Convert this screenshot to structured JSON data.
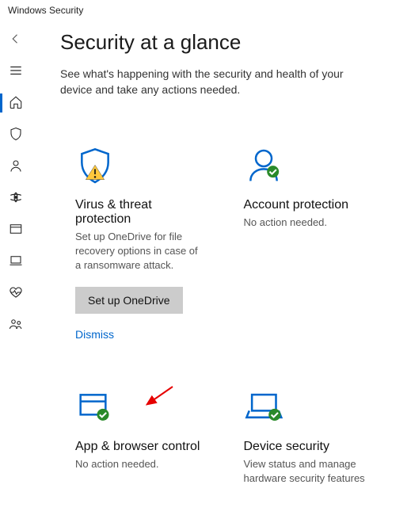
{
  "window_title": "Windows Security",
  "page": {
    "title": "Security at a glance",
    "subtitle": "See what's happening with the security and health of your device and take any actions needed."
  },
  "sidebar": [
    {
      "name": "back"
    },
    {
      "name": "menu"
    },
    {
      "name": "home",
      "active": true
    },
    {
      "name": "shield"
    },
    {
      "name": "account"
    },
    {
      "name": "network"
    },
    {
      "name": "browser"
    },
    {
      "name": "device"
    },
    {
      "name": "health"
    },
    {
      "name": "family"
    }
  ],
  "cards": {
    "virus": {
      "title": "Virus & threat protection",
      "text": "Set up OneDrive for file recovery options in case of a ransomware attack.",
      "button": "Set up OneDrive",
      "dismiss": "Dismiss",
      "status": "warning"
    },
    "account": {
      "title": "Account protection",
      "text": "No action needed.",
      "status": "ok"
    },
    "appbrowser": {
      "title": "App & browser control",
      "text": "No action needed.",
      "status": "ok"
    },
    "device": {
      "title": "Device security",
      "text": "View status and manage hardware security features",
      "status": "ok"
    }
  }
}
